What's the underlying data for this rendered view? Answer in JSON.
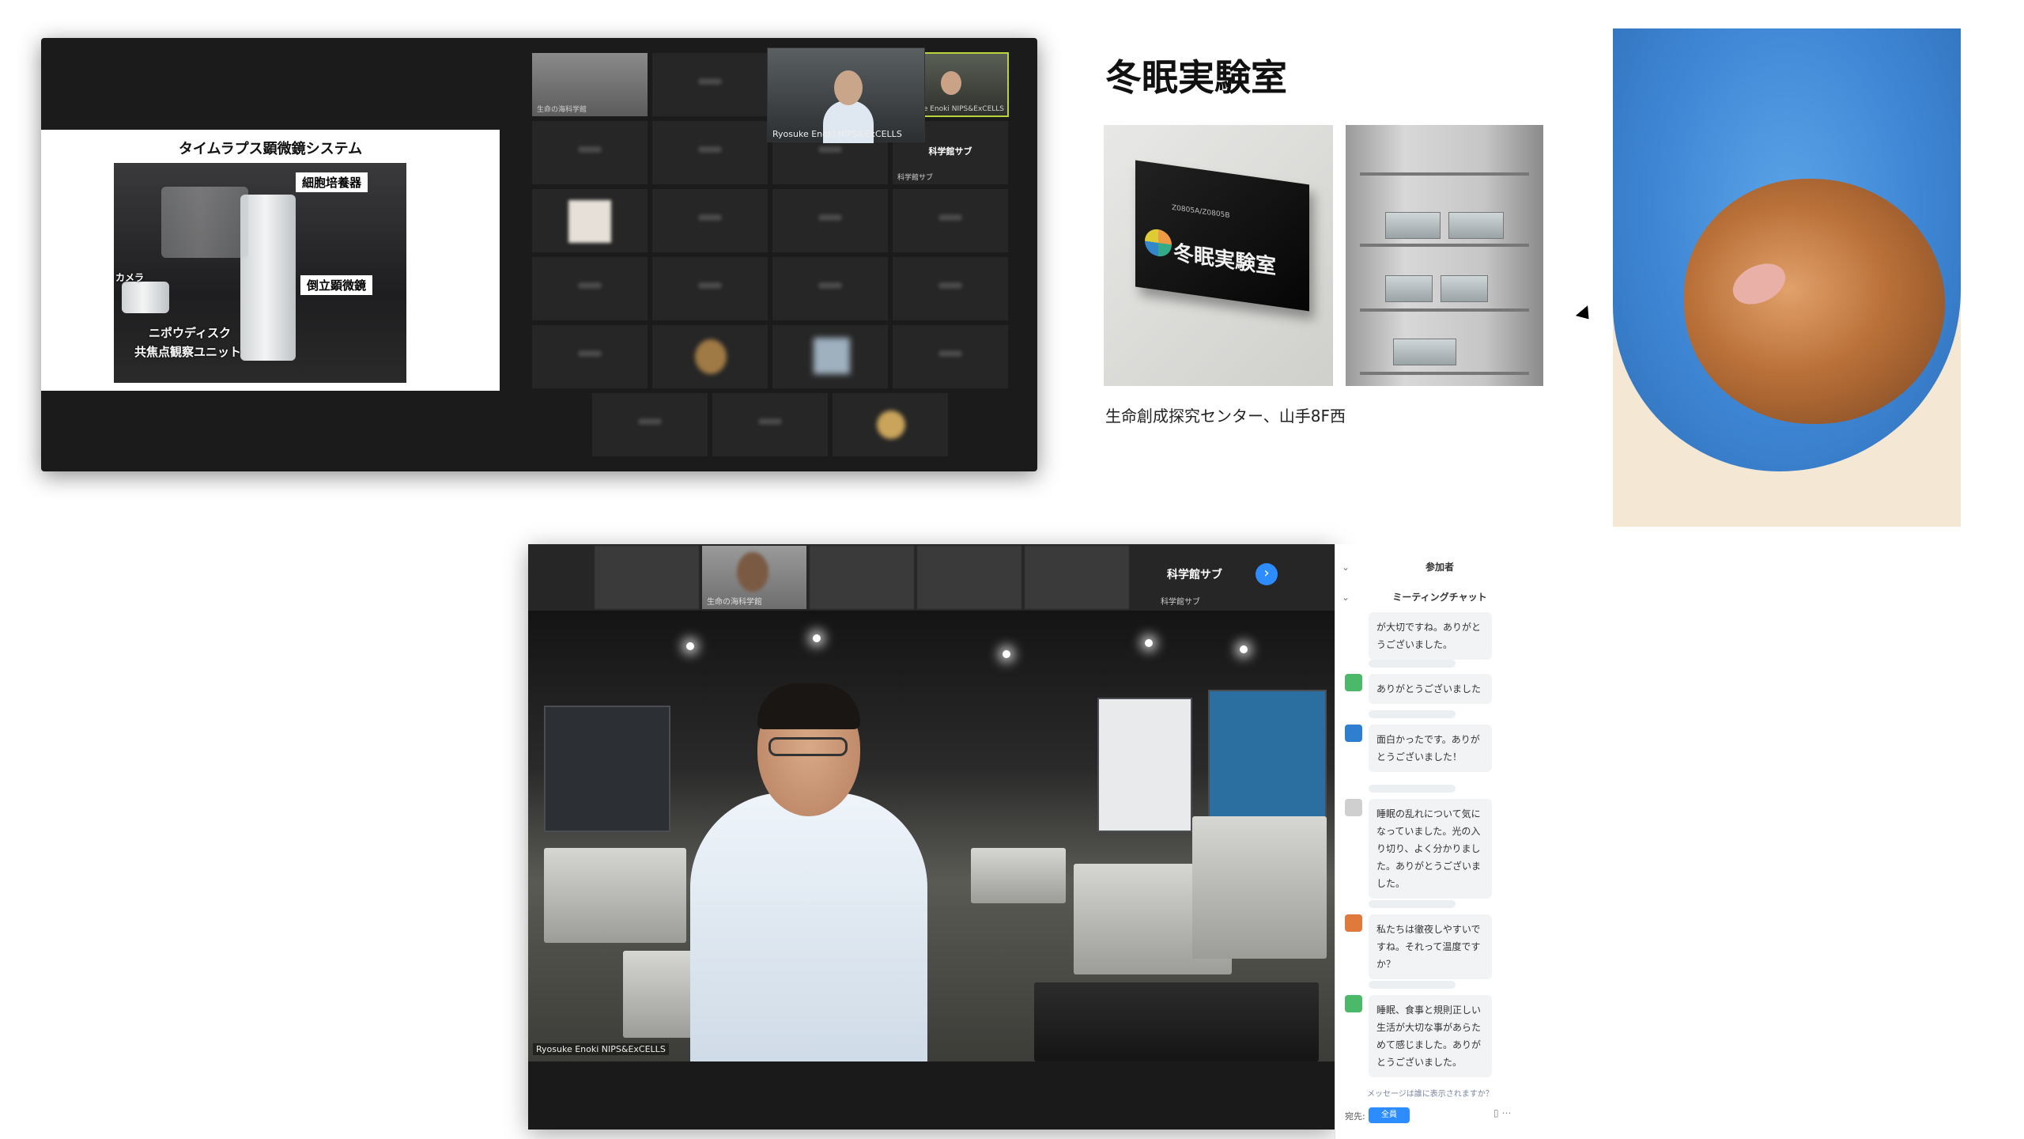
{
  "panel1": {
    "slide": {
      "title": "タイムラプス顕微鏡システム",
      "labels": {
        "incubator": "細胞培養器",
        "camera": "カメラ",
        "microscope": "倒立顕微鏡",
        "nipkow": "ニポウディスク",
        "confocal": "共焦点観察ユニット"
      }
    },
    "tiles": [
      {
        "name": "生命の海科学館"
      },
      {
        "name": ""
      },
      {
        "name": ""
      },
      {
        "name": "Ryosuke Enoki NIPS&ExCELLS"
      },
      {
        "name": ""
      },
      {
        "name": ""
      },
      {
        "name": ""
      },
      {
        "name": "科学館サブ",
        "label": "科学館サブ"
      },
      {
        "name": ""
      },
      {
        "name": ""
      },
      {
        "name": ""
      },
      {
        "name": ""
      },
      {
        "name": ""
      },
      {
        "name": ""
      },
      {
        "name": ""
      },
      {
        "name": ""
      },
      {
        "name": ""
      },
      {
        "name": ""
      },
      {
        "name": ""
      },
      {
        "name": ""
      },
      {
        "name": ""
      },
      {
        "name": ""
      },
      {
        "name": ""
      }
    ]
  },
  "panel2": {
    "title": "冬眠実験室",
    "sign_text": "冬眠実験室",
    "sign_code": "Z0805A/Z0805B",
    "caption": "生命創成探究センター、山手8F西",
    "pip_name": "Ryosuke Enoki NIPS&ExCELLS"
  },
  "panel3": {
    "strip": {
      "tiles": [
        {
          "name": ""
        },
        {
          "name": "生命の海科学館"
        },
        {
          "name": ""
        },
        {
          "name": ""
        },
        {
          "name": ""
        }
      ],
      "current_name": "科学館サブ",
      "current_sub": "科学館サブ",
      "next_icon": "chevron-right-icon"
    },
    "main_name": "Ryosuke Enoki NIPS&ExCELLS"
  },
  "chat": {
    "participants_header": "参加者",
    "chat_header": "ミーティングチャット",
    "messages": [
      {
        "text": "が大切ですね。ありがとうございました。",
        "color": "#ffffff"
      },
      {
        "text": "ありがとうございました",
        "color": "#4cb86a"
      },
      {
        "text": "面白かったです。ありがとうございました！",
        "color": "#2f7fd0"
      },
      {
        "text": "睡眠の乱れについて気になっていました。光の入り切り、よく分かりました。ありがとうございました。",
        "color": "#cfcfcf"
      },
      {
        "text": "私たちは徹夜しやすいですね。それって温度ですか？",
        "color": "#e07a3c"
      },
      {
        "text": "睡眠、食事と規則正しい生活が大切な事があらためて感じました。ありがとうございました。",
        "color": "#4cb86a"
      }
    ],
    "notice": "メッセージは誰に表示されますか？",
    "to_label": "宛先:",
    "to_value": "全員",
    "icons": [
      "file-icon",
      "more-icon"
    ]
  },
  "colors": {
    "zoom_blue": "#2d8cff",
    "active_speaker": "#b8d33c",
    "glove_blue": "#3e86d4"
  }
}
